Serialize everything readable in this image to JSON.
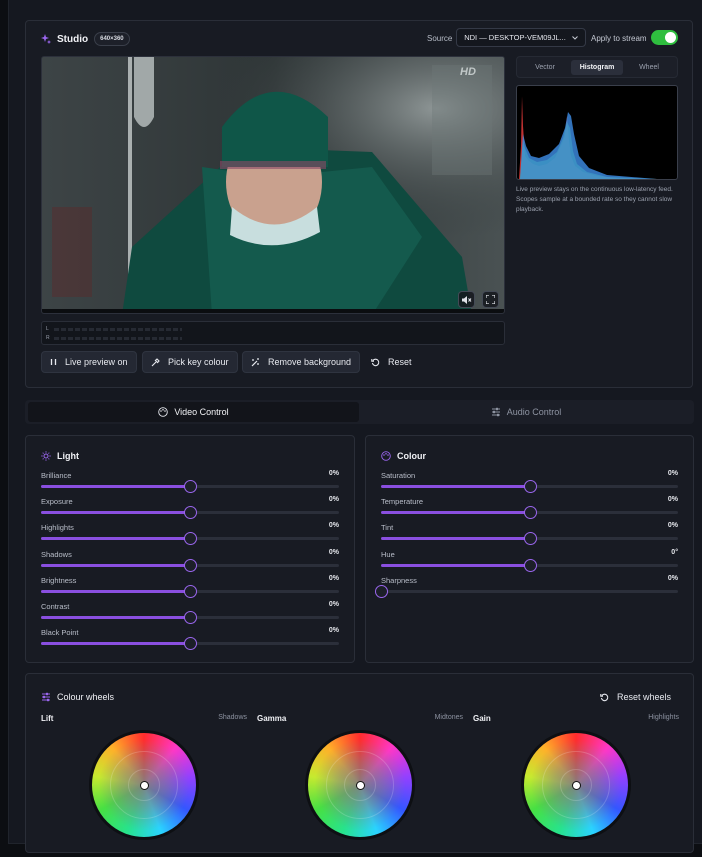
{
  "studio": {
    "title": "Studio",
    "resolution": "640×360",
    "source_label": "Source",
    "source_value": "NDI — DESKTOP-VEM09JL...",
    "apply_label": "Apply to stream",
    "apply_enabled": true,
    "preview_overlay_text": "HD",
    "meter_channels": [
      "L",
      "R"
    ]
  },
  "actions": {
    "live_preview": "Live preview on",
    "pick_key": "Pick key colour",
    "remove_bg": "Remove background",
    "reset": "Reset"
  },
  "scopes": {
    "tabs": [
      "Vector",
      "Histogram",
      "Wheel"
    ],
    "active": "Histogram",
    "note": "Live preview stays on the continuous low-latency feed. Scopes sample at a bounded rate so they cannot slow playback."
  },
  "control_tabs": {
    "video": "Video Control",
    "audio": "Audio Control",
    "active": "video"
  },
  "light": {
    "title": "Light",
    "sliders": [
      {
        "label": "Brilliance",
        "value": "0%",
        "level": 0.5
      },
      {
        "label": "Exposure",
        "value": "0%",
        "level": 0.5
      },
      {
        "label": "Highlights",
        "value": "0%",
        "level": 0.5
      },
      {
        "label": "Shadows",
        "value": "0%",
        "level": 0.5
      },
      {
        "label": "Brightness",
        "value": "0%",
        "level": 0.5
      },
      {
        "label": "Contrast",
        "value": "0%",
        "level": 0.5
      },
      {
        "label": "Black Point",
        "value": "0%",
        "level": 0.5
      }
    ]
  },
  "colour": {
    "title": "Colour",
    "sliders": [
      {
        "label": "Saturation",
        "value": "0%",
        "level": 0.5
      },
      {
        "label": "Temperature",
        "value": "0%",
        "level": 0.5
      },
      {
        "label": "Tint",
        "value": "0%",
        "level": 0.5
      },
      {
        "label": "Hue",
        "value": "0°",
        "level": 0.5
      },
      {
        "label": "Sharpness",
        "value": "0%",
        "level": 0.0
      }
    ]
  },
  "wheels": {
    "title": "Colour wheels",
    "reset": "Reset wheels",
    "items": [
      {
        "name": "Lift",
        "range": "Shadows"
      },
      {
        "name": "Gamma",
        "range": "Midtones"
      },
      {
        "name": "Gain",
        "range": "Highlights"
      }
    ]
  },
  "colors": {
    "accent": "#8a4fe0",
    "toggle_on": "#2fbe3f",
    "background": "#151820"
  }
}
